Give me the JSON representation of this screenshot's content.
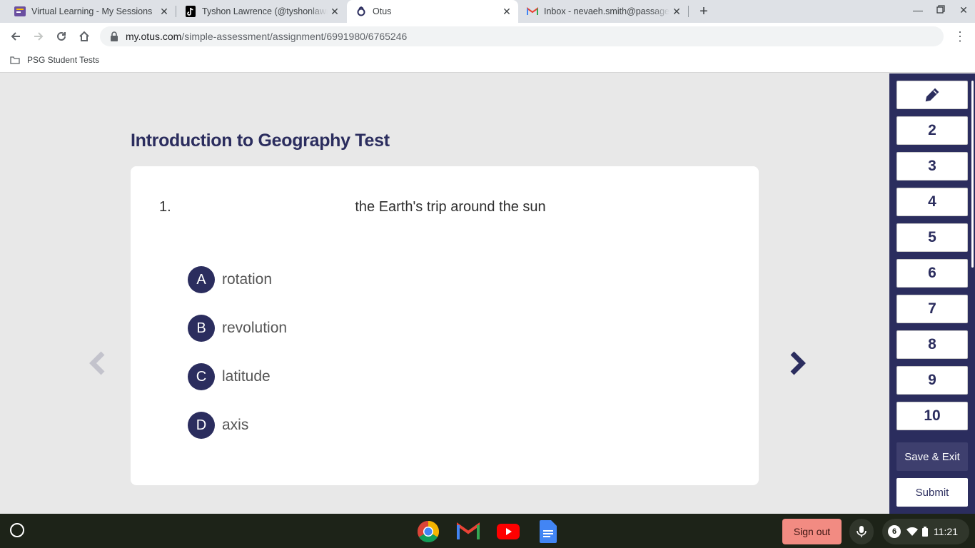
{
  "tabs": [
    {
      "title": "Virtual Learning - My Sessions",
      "active": false
    },
    {
      "title": "Tyshon Lawrence (@tyshonlawrence",
      "active": false
    },
    {
      "title": "Otus",
      "active": true
    },
    {
      "title": "Inbox - nevaeh.smith@passages",
      "active": false
    }
  ],
  "address_bar": {
    "host": "my.otus.com",
    "path": "/simple-assessment/assignment/6991980/6765246"
  },
  "bookmarks": [
    {
      "label": "PSG Student Tests"
    }
  ],
  "assessment": {
    "title": "Introduction to Geography Test",
    "question_number": "1.",
    "question_text": "the Earth's trip around the sun",
    "options": [
      {
        "letter": "A",
        "text": "rotation"
      },
      {
        "letter": "B",
        "text": "revolution"
      },
      {
        "letter": "C",
        "text": "latitude"
      },
      {
        "letter": "D",
        "text": "axis"
      }
    ]
  },
  "sidebar": {
    "questions": [
      "2",
      "3",
      "4",
      "5",
      "6",
      "7",
      "8",
      "9",
      "10"
    ],
    "save_exit": "Save & Exit",
    "submit": "Submit"
  },
  "shelf": {
    "sign_out": "Sign out",
    "notification_count": "6",
    "time": "11:21"
  },
  "colors": {
    "navy": "#2b2d5e",
    "sign_out_bg": "#f28b82",
    "shelf_bg": "#1d2318"
  }
}
